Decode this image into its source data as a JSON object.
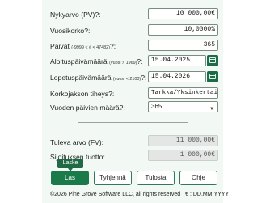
{
  "fields": {
    "pv_label": "Nykyarvo (PV)?:",
    "pv_value": "10 000,00€",
    "rate_label": "Vuosikorko?:",
    "rate_value": "10,0000%",
    "days_label_main": "Päivät",
    "days_label_note": "(-9999 < # < 47482)",
    "days_label_end": "?:",
    "days_value": "365",
    "start_label_main": "Aloituspäivämäärä",
    "start_label_note": "(vuosi > 1969)",
    "start_label_end": "?:",
    "start_value": "15.04.2025",
    "end_label_main": "Lopetuspäivämäärä",
    "end_label_note": "(vuosi < 2100)",
    "end_label_end": "?:",
    "end_value": "15.04.2026",
    "freq_label": "Korkojakson tiheys?:",
    "freq_value": "Tarkka/Yksinkertainen",
    "year_days_label": "Vuoden päivien määrä?:",
    "year_days_value": "365"
  },
  "results": {
    "fv_label": "Tuleva arvo (FV):",
    "fv_value": "11 000,00€",
    "return_label": "Sijoituksen tuotto:",
    "return_value": "1 000,00€"
  },
  "buttons": {
    "calculate": "Las",
    "calculate_tooltip": "Laske",
    "clear": "Tyhjennä",
    "print": "Tulosta",
    "help": "Ohje"
  },
  "footer": {
    "copyright": "©2026 Pine Grove Software LLC, all rights reserved",
    "format": "€ : DD.MM.YYYY"
  },
  "colors": {
    "accent": "#1a7a4a",
    "panel": "#f2f8f4"
  }
}
